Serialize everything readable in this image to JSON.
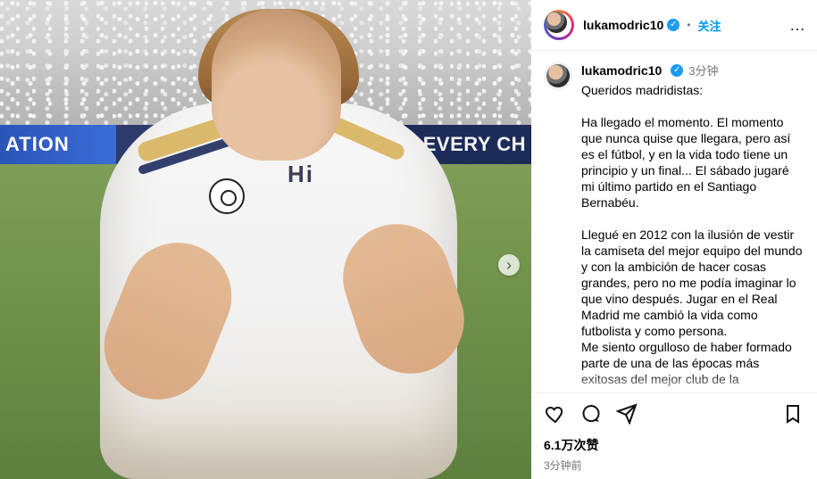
{
  "post": {
    "author": "lukamodric10",
    "follow_label": "关注",
    "more_label": "…",
    "posted_ago_short": "3分钟",
    "caption": "Queridos madridistas:\n\nHa llegado el momento. El momento que nunca quise que llegara, pero así es el fútbol, y en la vida todo tiene un principio y un final... El sábado jugaré mi último partido en el Santiago Bernabéu.\n\nLlegué en 2012 con la ilusión de vestir la camiseta del mejor equipo del mundo y con la ambición de hacer cosas grandes, pero no me podía imaginar lo que vino después. Jugar en el Real Madrid me cambió la vida como futbolista y como persona.\nMe siento orgulloso de haber formado parte de una de las épocas más exitosas del mejor club de la",
    "likes_label": "6.1万次赞",
    "timestamp": "3分钟前"
  },
  "photo": {
    "board_left_text": "ATION",
    "board_right_text": "SE EVERY CH",
    "sponsor_text": "Hi",
    "next_icon": "chevron-right-icon"
  },
  "icons": {
    "like": "heart-icon",
    "comment": "comment-icon",
    "share": "send-icon",
    "save": "bookmark-icon",
    "verified": "verified-badge-icon"
  },
  "colors": {
    "accent": "#0095f6",
    "verified": "#1d9bf0",
    "text_muted": "#737373"
  }
}
